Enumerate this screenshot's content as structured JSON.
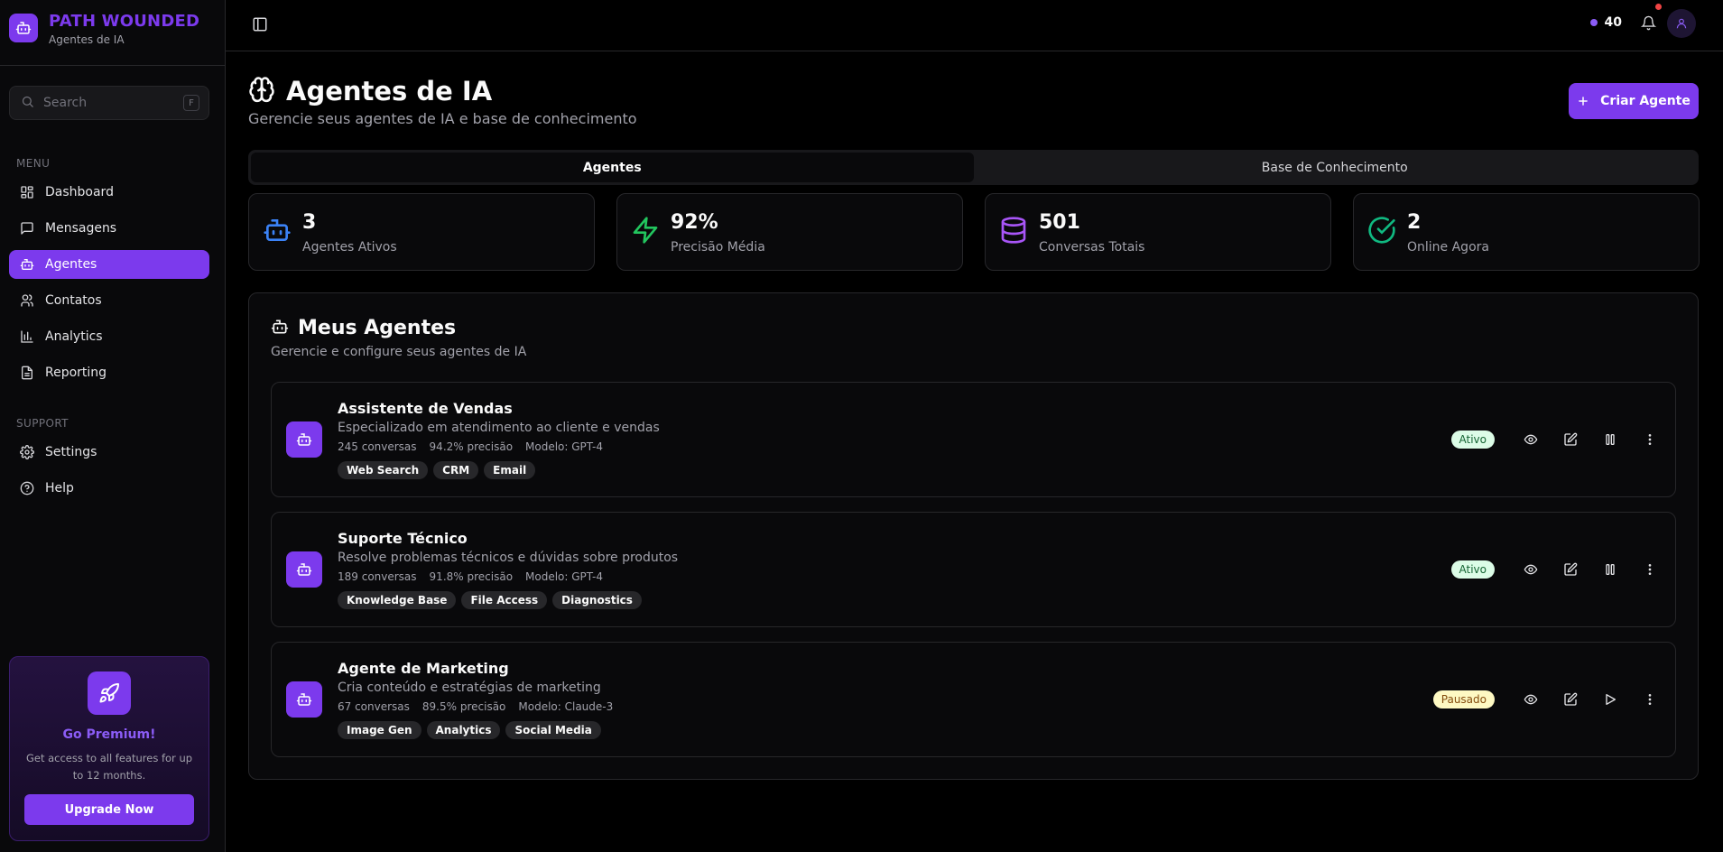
{
  "brand": {
    "title": "PATH WOUNDED",
    "subtitle": "Agentes de IA"
  },
  "search": {
    "placeholder": "Search",
    "shortcut": "F"
  },
  "sidebar": {
    "menu_label": "MENU",
    "items": [
      {
        "label": "Dashboard",
        "icon": "dashboard-icon"
      },
      {
        "label": "Mensagens",
        "icon": "message-icon"
      },
      {
        "label": "Agentes",
        "icon": "bot-icon",
        "active": true
      },
      {
        "label": "Contatos",
        "icon": "users-icon"
      },
      {
        "label": "Analytics",
        "icon": "bar-chart-icon"
      },
      {
        "label": "Reporting",
        "icon": "file-icon"
      }
    ],
    "support_label": "SUPPORT",
    "support_items": [
      {
        "label": "Settings",
        "icon": "gear-icon"
      },
      {
        "label": "Help",
        "icon": "help-icon"
      }
    ]
  },
  "premium": {
    "title": "Go Premium!",
    "description": "Get access to all features for up to 12 months.",
    "button": "Upgrade Now"
  },
  "header": {
    "credits": "40"
  },
  "page": {
    "title": "Agentes de IA",
    "subtitle": "Gerencie seus agentes de IA e base de conhecimento",
    "create_button": "Criar Agente"
  },
  "tabs": [
    {
      "label": "Agentes",
      "active": true
    },
    {
      "label": "Base de Conhecimento",
      "active": false
    }
  ],
  "stats": [
    {
      "value": "3",
      "label": "Agentes Ativos",
      "color": "#3b82f6"
    },
    {
      "value": "92%",
      "label": "Precisão Média",
      "color": "#22c55e"
    },
    {
      "value": "501",
      "label": "Conversas Totais",
      "color": "#a855f7"
    },
    {
      "value": "2",
      "label": "Online Agora",
      "color": "#10b981"
    }
  ],
  "agents_panel": {
    "title": "Meus Agentes",
    "subtitle": "Gerencie e configure seus agentes de IA"
  },
  "agents": [
    {
      "name": "Assistente de Vendas",
      "description": "Especializado em atendimento ao cliente e vendas",
      "conversations": "245 conversas",
      "precision": "94.2% precisão",
      "model": "Modelo: GPT-4",
      "tags": [
        "Web Search",
        "CRM",
        "Email"
      ],
      "status": "Ativo"
    },
    {
      "name": "Suporte Técnico",
      "description": "Resolve problemas técnicos e dúvidas sobre produtos",
      "conversations": "189 conversas",
      "precision": "91.8% precisão",
      "model": "Modelo: GPT-4",
      "tags": [
        "Knowledge Base",
        "File Access",
        "Diagnostics"
      ],
      "status": "Ativo"
    },
    {
      "name": "Agente de Marketing",
      "description": "Cria conteúdo e estratégias de marketing",
      "conversations": "67 conversas",
      "precision": "89.5% precisão",
      "model": "Modelo: Claude-3",
      "tags": [
        "Image Gen",
        "Analytics",
        "Social Media"
      ],
      "status": "Pausado"
    }
  ],
  "colors": {
    "accent": "#7c3aed",
    "background": "#000000",
    "surface": "#09090b",
    "border": "#27272a"
  }
}
